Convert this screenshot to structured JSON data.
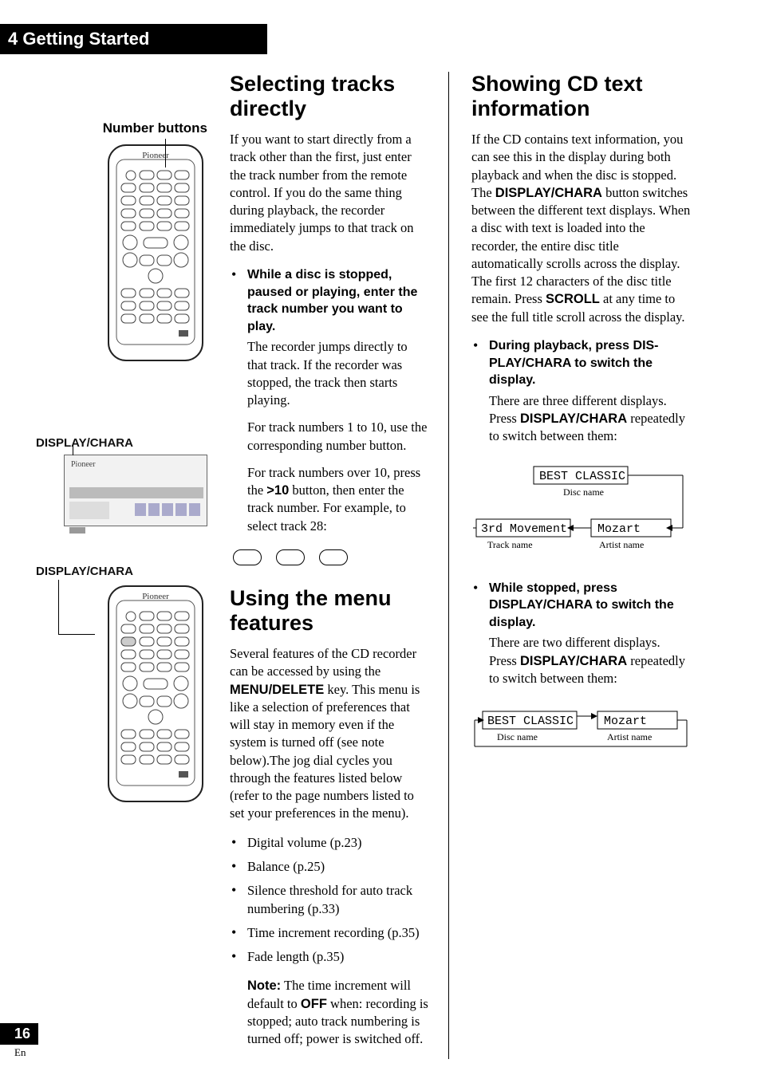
{
  "chapter": {
    "num": "4",
    "title": "Getting Started"
  },
  "left": {
    "number_buttons_label": "Number buttons",
    "display_chara_label_1": "DISPLAY/CHARA",
    "display_chara_label_2": "DISPLAY/CHARA"
  },
  "mid": {
    "sec1_title": "Selecting tracks directly",
    "sec1_intro": "If you want to start directly from a track other than the first, just enter the track number from the remote control. If you do the same thing during playback, the recorder immediately jumps to that track on the disc.",
    "sec1_bullet_lead": "While a disc is stopped, paused or playing, enter the track number you want to play.",
    "sec1_bullet_p1": "The recorder jumps directly to that track. If the recorder was stopped, the track then starts playing.",
    "sec1_bullet_p2": "For track numbers 1 to 10, use the corresponding number button.",
    "sec1_bullet_p3a": "For track numbers over 10, press the ",
    "sec1_bullet_p3b": ">10",
    "sec1_bullet_p3c": " button, then enter the track number. For example, to select track 28:",
    "sec2_title": "Using the menu features",
    "sec2_p1a": "Several features of the CD recorder can be accessed by using the ",
    "sec2_p1b": "MENU/DELETE",
    "sec2_p1c": " key. This menu is like a selection of preferences that will stay in memory even if the system is turned off (see note below).The jog dial cycles you through the features listed below (refer to the page numbers listed to set your preferences in the menu).",
    "menu_items": [
      "Digital volume (p.23)",
      "Balance (p.25)",
      "Silence threshold for auto track numbering (p.33)",
      "Time increment recording (p.35)",
      "Fade length (p.35)"
    ],
    "note_label": "Note:",
    "note_a": " The time increment will default to ",
    "note_b": "OFF",
    "note_c": " when: recording is stopped; auto track numbering is turned off; power is switched off."
  },
  "right": {
    "sec3_title": "Showing CD text information",
    "sec3_p1a": "If the CD contains text information, you can see this in the display during both playback and when the disc is stopped. The ",
    "sec3_p1b": "DISPLAY/CHARA",
    "sec3_p1c": " button switches between the different text displays. When a disc with text is loaded into the recorder, the entire disc title automatically scrolls across the display. The first 12 characters of the disc title remain. Press ",
    "sec3_p1d": "SCROLL",
    "sec3_p1e": " at any time to see the full title scroll across the display.",
    "sec3_b1_lead": "During playback, press DIS-PLAY/CHARA to switch the display.",
    "sec3_b1_p1a": "There are three different displays. Press ",
    "sec3_b1_p1b": "DISPLAY/CHARA",
    "sec3_b1_p1c": " repeatedly to switch between them:",
    "diag1": {
      "disc": "BEST CLASSIC",
      "disc_label": "Disc name",
      "track": "3rd Movement",
      "track_label": "Track name",
      "artist": "Mozart",
      "artist_label": "Artist name"
    },
    "sec3_b2_lead": "While stopped, press DISPLAY/CHARA to switch the display.",
    "sec3_b2_p1a": "There are two different displays. Press ",
    "sec3_b2_p1b": "DISPLAY/CHARA",
    "sec3_b2_p1c": " repeatedly to switch between them:",
    "diag2": {
      "disc": "BEST CLASSIC",
      "disc_label": "Disc name",
      "artist": "Mozart",
      "artist_label": "Artist name"
    }
  },
  "footer": {
    "page": "16",
    "lang": "En"
  }
}
